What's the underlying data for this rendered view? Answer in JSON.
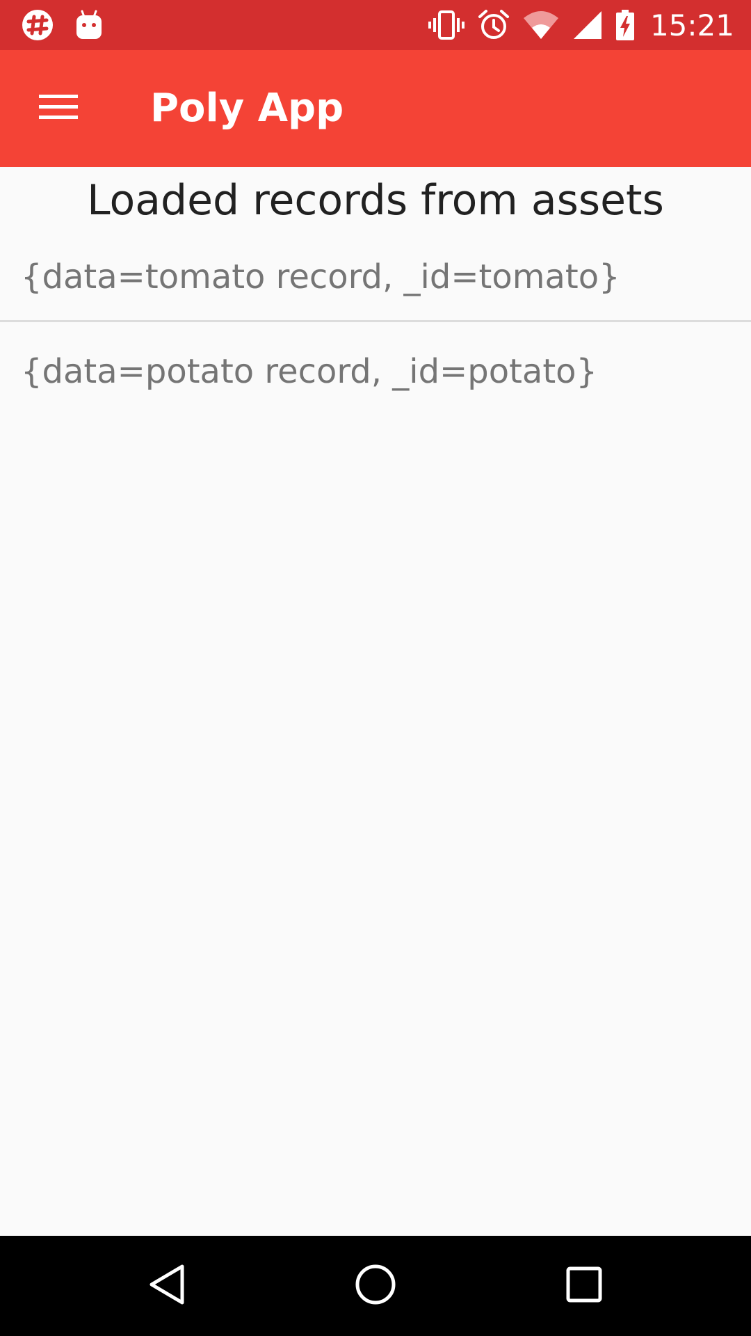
{
  "status_bar": {
    "time": "15:21",
    "left_icons": [
      "slack-icon",
      "android-debug-icon"
    ],
    "right_icons": [
      "vibrate-icon",
      "alarm-icon",
      "wifi-icon",
      "cell-signal-icon",
      "battery-charging-icon"
    ]
  },
  "app_bar": {
    "title": "Poly App",
    "menu_icon": "hamburger-menu-icon"
  },
  "main": {
    "heading": "Loaded records from assets",
    "records": [
      "{data=tomato record, _id=tomato}",
      "{data=potato record, _id=potato}"
    ]
  },
  "nav_bar": {
    "icons": [
      "back-icon",
      "home-icon",
      "recents-icon"
    ]
  },
  "colors": {
    "status_bar": "#d32f2f",
    "app_bar": "#f44336",
    "background": "#fafafa",
    "heading_text": "#212121",
    "record_text": "#757575",
    "divider": "#dcdcdc",
    "nav_bar": "#000000"
  }
}
